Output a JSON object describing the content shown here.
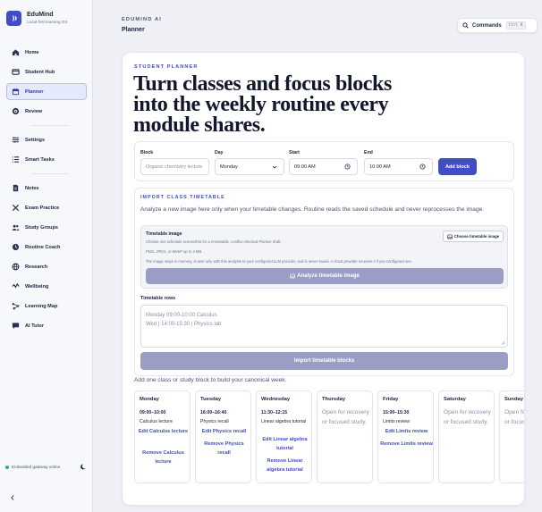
{
  "brand": {
    "name": "EduMind",
    "subtitle": "Local-first learning OS"
  },
  "sidebar": {
    "groups": [
      [
        {
          "label": "Home",
          "icon": "home-icon",
          "active": false
        },
        {
          "label": "Student Hub",
          "icon": "hub-icon",
          "active": false
        },
        {
          "label": "Planner",
          "icon": "calendar-icon",
          "active": true
        },
        {
          "label": "Review",
          "icon": "review-icon",
          "active": false
        }
      ],
      [
        {
          "label": "Settings",
          "icon": "settings-icon",
          "active": false
        },
        {
          "label": "Smart Tasks",
          "icon": "tasks-icon",
          "active": false
        }
      ],
      [
        {
          "label": "Notes",
          "icon": "notes-icon",
          "active": false
        },
        {
          "label": "Exam Practice",
          "icon": "exam-icon",
          "active": false
        },
        {
          "label": "Study Groups",
          "icon": "groups-icon",
          "active": false
        },
        {
          "label": "Routine Coach",
          "icon": "clock-icon",
          "active": false
        },
        {
          "label": "Research",
          "icon": "research-icon",
          "active": false
        },
        {
          "label": "Wellbeing",
          "icon": "wellbeing-icon",
          "active": false
        },
        {
          "label": "Learning Map",
          "icon": "map-icon",
          "active": false
        },
        {
          "label": "AI Tutor",
          "icon": "tutor-icon",
          "active": false
        }
      ]
    ],
    "gateway_status": "Embedded gateway online"
  },
  "header": {
    "breadcrumb": "EDUMIND AI",
    "title": "Planner",
    "command": {
      "label": "Commands",
      "shortcut": "Ctrl K"
    }
  },
  "hero": {
    "eyebrow": "STUDENT PLANNER",
    "headline": "Turn classes and focus blocks into the weekly routine every module shares."
  },
  "form": {
    "block_label": "Block",
    "block_placeholder": "Organic chemistry lecture",
    "day_label": "Day",
    "day_value": "Monday",
    "start_label": "Start",
    "start_value": "09:00  AM",
    "end_label": "End",
    "end_value": "10:00  AM",
    "add_label": "Add block"
  },
  "import": {
    "title": "IMPORT CLASS TIMETABLE",
    "description": "Analyze a new image here only when your timetable changes. Routine reads the saved schedule and never reprocesses the image.",
    "upload_title": "Timetable image",
    "upload_lines": [
      "Choose one schedule screenshot for a reviewable, conflict-checked Planner draft.",
      "PNG, JPEG, or WebP up to 4 MB.",
      "The image stays in memory, is sent only with this analysis to your configured LLM provider, and is never saved. A cloud provider receives it if you configured one."
    ],
    "choose_label": "Choose timetable image",
    "analyze_label": "Analyze timetable image",
    "rows_label": "Timetable rows",
    "rows_placeholder": [
      "Monday 09:00-10:00 Calculus",
      "Wed | 14:00-15:30 | Physics lab"
    ],
    "import_label": "Import timetable blocks"
  },
  "hint": "Add one class or study block to build your canonical week.",
  "week": [
    {
      "day": "Monday",
      "time": "09:00–10:00",
      "title": "Calculus lecture",
      "edit": "Edit Calculus lecture",
      "remove": "Remove Calculus lecture",
      "empty": ""
    },
    {
      "day": "Tuesday",
      "time": "16:00–16:40",
      "title": "Physics recall",
      "edit": "Edit Physics recall",
      "remove": "Remove Physics recall",
      "empty": ""
    },
    {
      "day": "Wednesday",
      "time": "11:30–12:15",
      "title": "Linear algebra tutorial",
      "edit": "Edit Linear algebra tutorial",
      "remove": "Remove Linear algebra tutorial",
      "empty": ""
    },
    {
      "day": "Thursday",
      "time": "",
      "title": "",
      "edit": "",
      "remove": "",
      "empty": "Open for recovery or focused study."
    },
    {
      "day": "Friday",
      "time": "15:00–15:30",
      "title": "Limits review",
      "edit": "Edit Limits review",
      "remove": "Remove Limits review",
      "empty": ""
    },
    {
      "day": "Saturday",
      "time": "",
      "title": "",
      "edit": "",
      "remove": "",
      "empty": "Open for recovery or focused study."
    },
    {
      "day": "Sunday",
      "time": "",
      "title": "",
      "edit": "",
      "remove": "",
      "empty": "Open for recovery or focused study."
    }
  ],
  "colors": {
    "accent": "#3f4ec4",
    "disabled": "#9a9ec4",
    "online": "#22b573"
  }
}
